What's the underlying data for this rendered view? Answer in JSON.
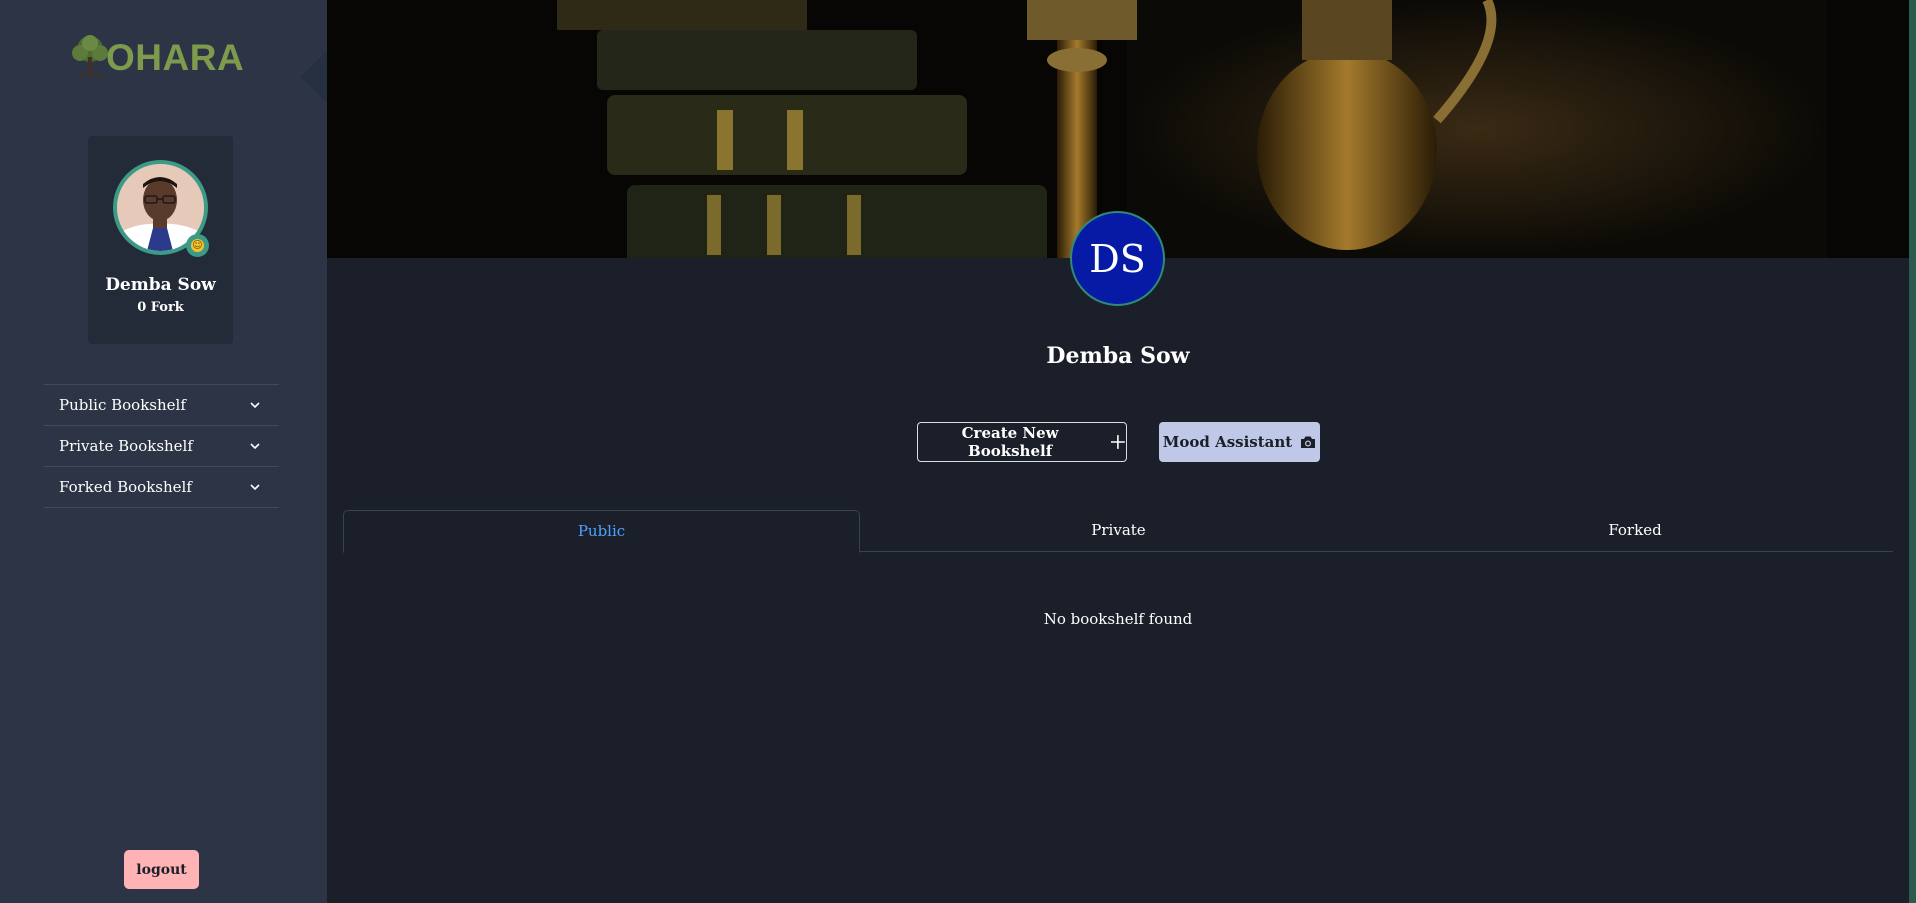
{
  "sidebar": {
    "logo_text": "OHARA",
    "logo_color": "#7e9a4d",
    "profile": {
      "name": "Demba Sow",
      "forks": "0 Fork",
      "status_icon": "smiley-icon"
    },
    "nav_items": [
      {
        "label": "Public Bookshelf",
        "icon": "chevron-down-icon"
      },
      {
        "label": "Private Bookshelf",
        "icon": "chevron-down-icon"
      },
      {
        "label": "Forked Bookshelf",
        "icon": "chevron-down-icon"
      }
    ],
    "logout_label": "logout"
  },
  "main": {
    "avatar_initials": "DS",
    "name": "Demba Sow",
    "buttons": {
      "create_label": "Create New Bookshelf",
      "create_icon": "plus-icon",
      "mood_label": "Mood Assistant",
      "mood_icon": "camera-icon"
    },
    "tabs": [
      {
        "label": "Public",
        "active": true
      },
      {
        "label": "Private",
        "active": false
      },
      {
        "label": "Forked",
        "active": false
      }
    ],
    "empty_message": "No bookshelf found"
  },
  "colors": {
    "sidebar_bg": "#2c3445",
    "main_bg": "#1b1f2a",
    "accent_blue": "#4da3ff",
    "avatar_bg": "#061aa6",
    "logout_bg": "#ffb3b5",
    "mood_bg": "#bfc8e6"
  }
}
